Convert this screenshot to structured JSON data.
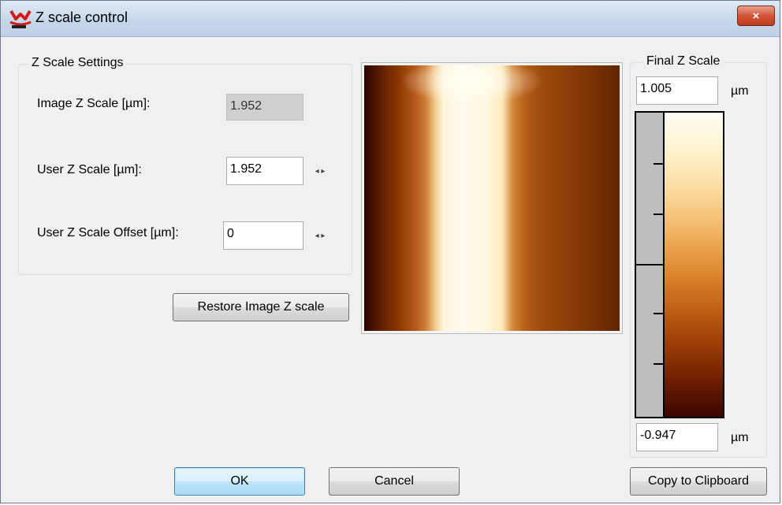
{
  "window": {
    "title": "Z scale control",
    "close_label": "×"
  },
  "z_scale_settings": {
    "legend": "Z Scale Settings",
    "image_z_scale_label": "Image Z Scale [µm]:",
    "image_z_scale_value": "1.952",
    "user_z_scale_label": "User Z Scale [µm]:",
    "user_z_scale_value": "1.952",
    "user_z_scale_offset_label": "User Z Scale Offset [µm]:",
    "user_z_scale_offset_value": "0",
    "spinner_glyph": "◂ ▸"
  },
  "restore_button_label": "Restore Image Z scale",
  "final_z_scale": {
    "legend": "Final Z Scale",
    "max_value": "1.005",
    "min_value": "-0.947",
    "unit": "µm",
    "colormap": [
      "#3a0500",
      "#9b3e06",
      "#dd8a30",
      "#fcdca2",
      "#fffdf2"
    ]
  },
  "buttons": {
    "ok": "OK",
    "cancel": "Cancel",
    "copy": "Copy to Clipboard"
  },
  "colors": {
    "close_button": "#c23a1f",
    "default_button_border": "#3c7fb1",
    "titlebar": "#c7d7ea"
  }
}
